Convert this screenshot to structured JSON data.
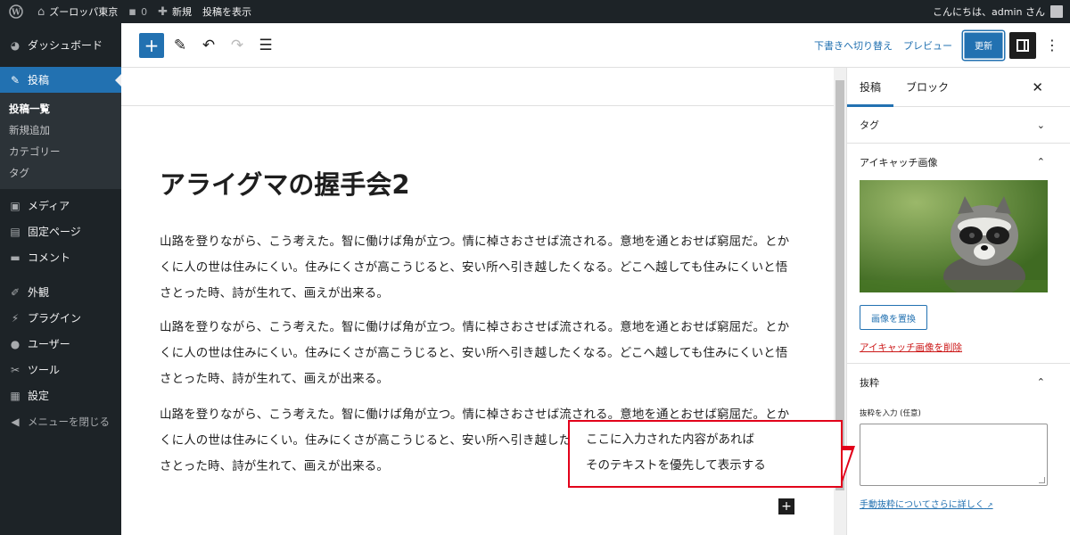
{
  "adminbar": {
    "site_name": "ズーロッパ東京",
    "comments_count": "0",
    "new_label": "新規",
    "view_post_label": "投稿を表示",
    "greeting": "こんにちは、admin さん"
  },
  "sidebar": {
    "dashboard": "ダッシュボード",
    "posts": "投稿",
    "submenu": [
      "投稿一覧",
      "新規追加",
      "カテゴリー",
      "タグ"
    ],
    "media": "メディア",
    "pages": "固定ページ",
    "comments": "コメント",
    "appearance": "外観",
    "plugins": "プラグイン",
    "users": "ユーザー",
    "settings": "設定",
    "collapse": "メニューを閉じる"
  },
  "header": {
    "switch_to_draft": "下書きへ切り替え",
    "preview": "プレビュー",
    "update": "更新"
  },
  "post": {
    "title": "アライグマの握手会2",
    "paragraphs": [
      "山路を登りながら、こう考えた。智に働けば角が立つ。情に棹さおさせば流される。意地を通とおせば窮屈だ。とかくに人の世は住みにくい。住みにくさが高こうじると、安い所へ引き越したくなる。どこへ越しても住みにくいと悟さとった時、詩が生れて、画えが出来る。",
      "山路を登りながら、こう考えた。智に働けば角が立つ。情に棹さおさせば流される。意地を通とおせば窮屈だ。とかくに人の世は住みにくい。住みにくさが高こうじると、安い所へ引き越したくなる。どこへ越しても住みにくいと悟さとった時、詩が生れて、画えが出来る。",
      "山路を登りながら、こう考えた。智に働けば角が立つ。情に棹さおさせば流される。意地を通とおせば窮屈だ。とかくに人の世は住みにくい。住みにくさが高こうじると、安い所へ引き越したくなる。どこへ越しても住みにくいと悟さとった時、詩が生れて、画えが出来る。"
    ]
  },
  "inspector": {
    "tab_post": "投稿",
    "tab_block": "ブロック",
    "tags_label": "タグ",
    "featured_label": "アイキャッチ画像",
    "replace_image": "画像を置換",
    "remove_image": "アイキャッチ画像を削除",
    "excerpt_label": "抜粋",
    "excerpt_field_label": "抜粋を入力 (任意)",
    "excerpt_value": "",
    "learn_more": "手動抜粋についてさらに詳しく"
  },
  "callout": {
    "line1": "ここに入力された内容があれば",
    "line2": "そのテキストを優先して表示する"
  },
  "colors": {
    "admin_dark": "#1d2327",
    "accent": "#2271b1",
    "danger": "#cc1818",
    "callout_border": "#e2001a"
  }
}
